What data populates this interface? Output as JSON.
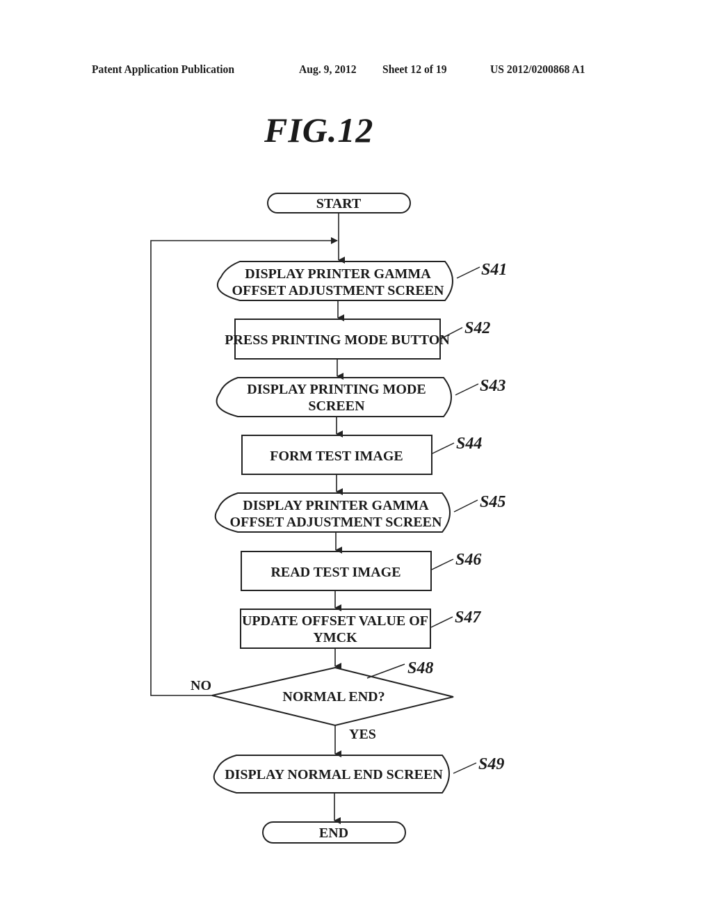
{
  "header": {
    "publication": "Patent Application Publication",
    "date": "Aug. 9, 2012",
    "sheet": "Sheet 12 of 19",
    "number": "US 2012/0200868 A1"
  },
  "figure": {
    "title": "FIG.12"
  },
  "flowchart": {
    "start": "START",
    "end": "END",
    "steps": [
      {
        "id": "S41",
        "type": "display",
        "lines": [
          "DISPLAY PRINTER GAMMA",
          "OFFSET ADJUSTMENT SCREEN"
        ]
      },
      {
        "id": "S42",
        "type": "process",
        "lines": [
          "PRESS PRINTING MODE BUTTON"
        ]
      },
      {
        "id": "S43",
        "type": "display",
        "lines": [
          "DISPLAY PRINTING MODE",
          "SCREEN"
        ]
      },
      {
        "id": "S44",
        "type": "process",
        "lines": [
          "FORM TEST IMAGE"
        ]
      },
      {
        "id": "S45",
        "type": "display",
        "lines": [
          "DISPLAY PRINTER GAMMA",
          "OFFSET ADJUSTMENT SCREEN"
        ]
      },
      {
        "id": "S46",
        "type": "process",
        "lines": [
          "READ TEST IMAGE"
        ]
      },
      {
        "id": "S47",
        "type": "process",
        "lines": [
          "UPDATE OFFSET VALUE OF",
          "YMCK"
        ]
      },
      {
        "id": "S48",
        "type": "decision",
        "lines": [
          "NORMAL END?"
        ]
      },
      {
        "id": "S49",
        "type": "display",
        "lines": [
          "DISPLAY NORMAL END SCREEN"
        ]
      }
    ],
    "branches": {
      "yes": "YES",
      "no": "NO"
    }
  }
}
